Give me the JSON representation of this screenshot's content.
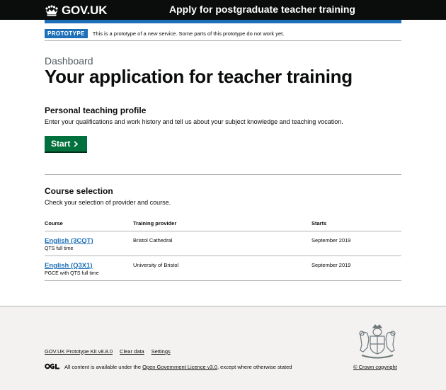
{
  "header": {
    "logo_text": "GOV.UK",
    "service_name": "Apply for postgraduate teacher training"
  },
  "phase_banner": {
    "tag": "PROTOTYPE",
    "text": "This is a prototype of a new service. Some parts of this prototype do not work yet."
  },
  "page": {
    "caption": "Dashboard",
    "title": "Your application for teacher training"
  },
  "profile": {
    "heading": "Personal teaching profile",
    "description": "Enter your qualifications and work history and tell us about your subject knowledge and teaching vocation.",
    "start_label": "Start"
  },
  "course_selection": {
    "heading": "Course selection",
    "description": "Check your selection of provider and course.",
    "columns": [
      "Course",
      "Training provider",
      "Starts"
    ],
    "rows": [
      {
        "course": "English (3CQT)",
        "qualification": "QTS full time",
        "provider": "Bristol Cathedral",
        "starts": "September 2019"
      },
      {
        "course": "English (Q3X1)",
        "qualification": "PGCE with QTS full time",
        "provider": "University of Bristol",
        "starts": "September 2019"
      }
    ]
  },
  "footer": {
    "links": [
      "GOV.UK Prototype Kit v8.8.0",
      "Clear data",
      "Settings"
    ],
    "licence_prefix": "All content is available under the ",
    "licence_link": "Open Government Licence v3.0",
    "licence_suffix": ", except where otherwise stated",
    "copyright": "© Crown copyright"
  },
  "colors": {
    "header_bg": "#0b0c0c",
    "brand_blue": "#1d70b8",
    "button_green": "#00703c",
    "footer_bg": "#f3f2f1"
  },
  "icons": [
    "crown-icon",
    "chevron-right-icon",
    "royal-arms-crest",
    "ogl-logo"
  ]
}
